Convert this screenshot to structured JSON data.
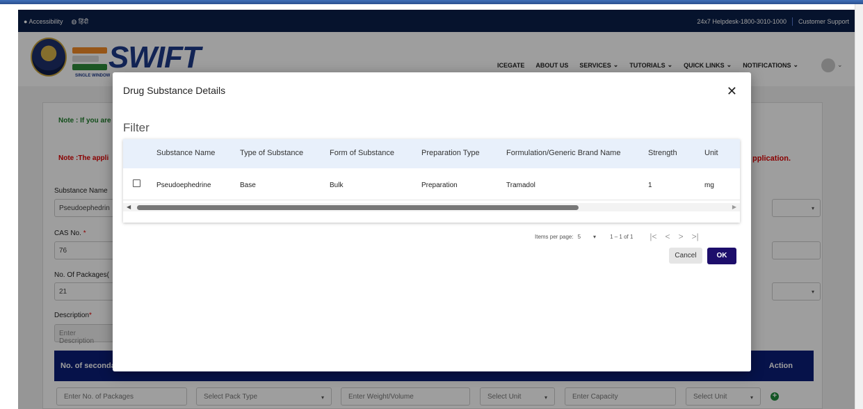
{
  "utility_bar": {
    "accessibility_label": "Accessibility",
    "language_label": "हिंदी",
    "helpdesk": "24x7 Helpdesk-1800-3010-1000",
    "support": "Customer Support"
  },
  "header": {
    "logo_text": "SWIFT",
    "logo_subtitle": "SINGLE WINDOW",
    "nav": [
      {
        "label": "ICEGATE"
      },
      {
        "label": "ABOUT US"
      },
      {
        "label": "SERVICES",
        "chevron": "⌄"
      },
      {
        "label": "TUTORIALS",
        "chevron": "⌄"
      },
      {
        "label": "QUICK LINKS",
        "chevron": "⌄"
      },
      {
        "label": "NOTIFICATIONS",
        "chevron": "⌄"
      }
    ],
    "avatar_chevron": "⌄",
    "brand_color": "#1e3a8a"
  },
  "form": {
    "note_green": "Note : If you are",
    "note_red_left": "Note :The appli",
    "note_red_right": "pplication.",
    "substance_name_label": "Substance Name",
    "substance_name_value": "Pseudoephedrin",
    "cas_label": "CAS No.",
    "cas_value": "76",
    "packages_label": "No. Of Packages(",
    "packages_value": "21",
    "description_label": "Description",
    "description_placeholder": "Enter Description",
    "required_mark": "*",
    "secondary_header": "No. of seconda",
    "action_header": "Action",
    "bottom_row": {
      "packages_placeholder": "Enter No. of Packages",
      "pack_type_placeholder": "Select Pack Type",
      "weight_placeholder": "Enter Weight/Volume",
      "unit_placeholder": "Select Unit",
      "capacity_placeholder": "Enter Capacity",
      "unit2_placeholder": "Select Unit",
      "add_symbol": "+"
    }
  },
  "modal": {
    "title": "Drug Substance Details",
    "close_symbol": "✕",
    "filter_label": "Filter",
    "columns": [
      "Substance Name",
      "Type of Substance",
      "Form of Substance",
      "Preparation Type",
      "Formulation/Generic Brand Name",
      "Strength",
      "Unit"
    ],
    "rows": [
      {
        "substance_name": "Pseudoephedrine",
        "type": "Base",
        "form": "Bulk",
        "preparation_type": "Preparation",
        "brand_name": "Tramadol",
        "strength": "1",
        "unit": "mg",
        "checked": false
      }
    ],
    "paginator": {
      "items_per_page_label": "Items per page:",
      "page_size": "5",
      "range": "1 – 1 of 1",
      "first_icon": "|<",
      "prev_icon": "<",
      "next_icon": ">",
      "last_icon": ">|"
    },
    "cancel_label": "Cancel",
    "ok_label": "OK",
    "ok_color": "#1d0e6b",
    "header_bg": "#e8f0fb"
  }
}
